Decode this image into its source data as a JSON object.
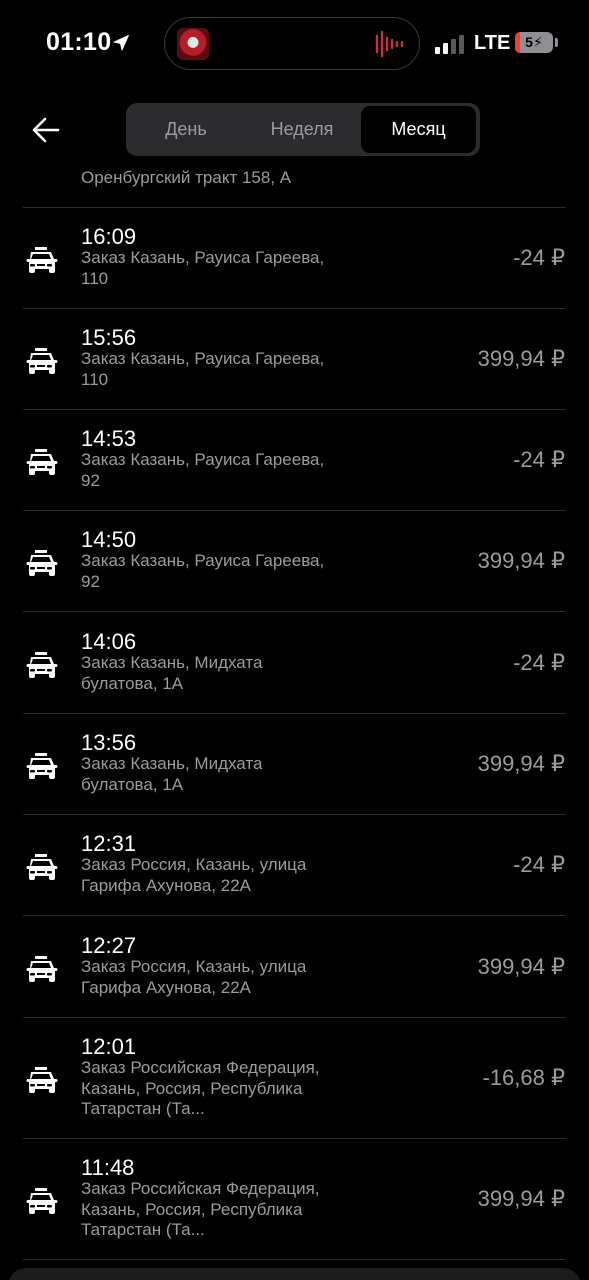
{
  "status_bar": {
    "time": "01:10",
    "network": "LTE",
    "battery": "5"
  },
  "header": {
    "segments": [
      "День",
      "Неделя",
      "Месяц"
    ],
    "selected": "Месяц"
  },
  "partial_row": {
    "addr": "Оренбургский тракт 158, А"
  },
  "transactions": [
    {
      "time": "16:09",
      "addr": "Заказ Казань, Рауиса Гареева, 110",
      "amount": "-24 ₽"
    },
    {
      "time": "15:56",
      "addr": "Заказ Казань, Рауиса Гареева, 110",
      "amount": "399,94 ₽"
    },
    {
      "time": "14:53",
      "addr": "Заказ Казань, Рауиса Гареева, 92",
      "amount": "-24 ₽"
    },
    {
      "time": "14:50",
      "addr": "Заказ Казань, Рауиса Гареева, 92",
      "amount": "399,94 ₽"
    },
    {
      "time": "14:06",
      "addr": "Заказ Казань, Мидхата булатова, 1А",
      "amount": "-24 ₽"
    },
    {
      "time": "13:56",
      "addr": "Заказ Казань, Мидхата булатова, 1А",
      "amount": "399,94 ₽"
    },
    {
      "time": "12:31",
      "addr": "Заказ Россия, Казань, улица Гарифа Ахунова, 22А",
      "amount": "-24 ₽"
    },
    {
      "time": "12:27",
      "addr": "Заказ Россия, Казань, улица Гарифа Ахунова, 22А",
      "amount": "399,94 ₽"
    },
    {
      "time": "12:01",
      "addr": "Заказ Российская Федерация, Казань, Россия, Республика Татарстан (Та...",
      "amount": "-16,68 ₽"
    },
    {
      "time": "11:48",
      "addr": "Заказ Российская Федерация, Казань, Россия, Республика Татарстан (Та...",
      "amount": "399,94 ₽"
    }
  ],
  "colors": {
    "background": "#000000",
    "secondary_text": "#9b9ba0",
    "segment_bg": "#2c2c2e"
  }
}
